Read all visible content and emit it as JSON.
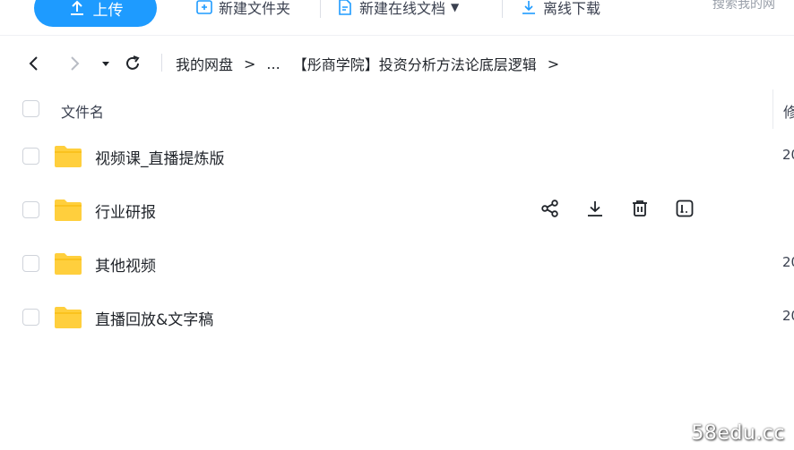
{
  "toolbar": {
    "upload_label": "上传",
    "new_folder_label": "新建文件夹",
    "new_online_doc_label": "新建在线文档",
    "offline_download_label": "离线下载",
    "search_text": "搜索我的网"
  },
  "nav": {
    "breadcrumbs": [
      "我的网盘",
      "...",
      "【彤商学院】投资分析方法论底层逻辑"
    ],
    "separator": ">"
  },
  "table": {
    "name_header": "文件名",
    "modified_header": "修"
  },
  "files": [
    {
      "name": "视频课_直播提炼版",
      "date": "20"
    },
    {
      "name": "行业研报",
      "date": ""
    },
    {
      "name": "其他视频",
      "date": "20"
    },
    {
      "name": "直播回放&文字稿",
      "date": "20"
    }
  ],
  "colors": {
    "accent": "#1e9bff",
    "folder": "#ffcf3d",
    "folder_tab": "#f4b400"
  },
  "watermark": "58edu.cc"
}
